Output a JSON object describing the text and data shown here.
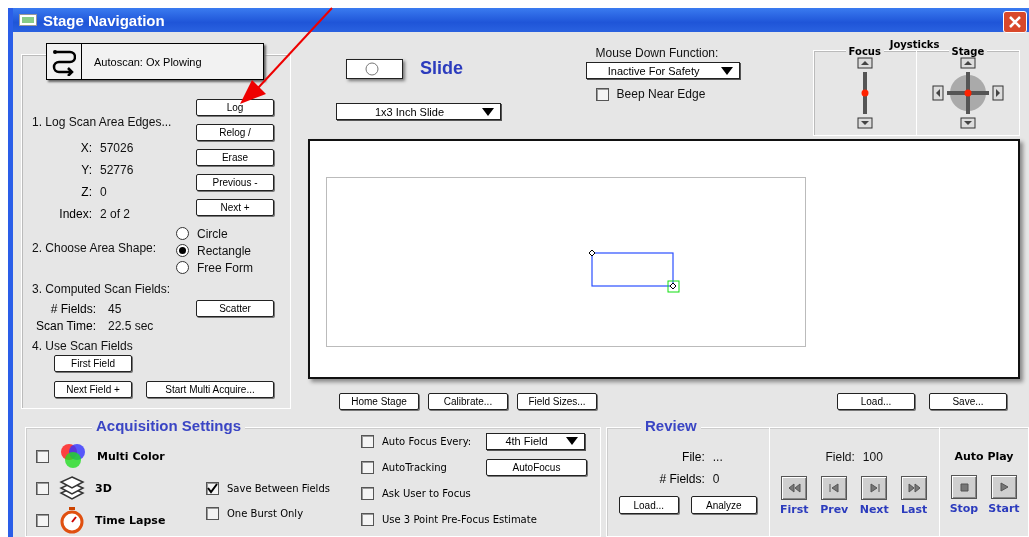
{
  "window": {
    "title": "Stage Navigation"
  },
  "autoscan": {
    "label": "Autoscan: Ox Plowing"
  },
  "log_section": {
    "heading": "1. Log Scan Area Edges...",
    "coords": [
      {
        "label": "X:",
        "value": "57026"
      },
      {
        "label": "Y:",
        "value": "52776"
      },
      {
        "label": "Z:",
        "value": "0"
      },
      {
        "label": "Index:",
        "value": "2 of 2"
      }
    ],
    "buttons": [
      "Log",
      "Relog  /",
      "Erase",
      "Previous -",
      "Next   +"
    ]
  },
  "shape_section": {
    "heading": "2. Choose Area Shape:",
    "options": [
      {
        "label": "Circle",
        "selected": false
      },
      {
        "label": "Rectangle",
        "selected": true
      },
      {
        "label": "Free Form",
        "selected": false
      }
    ]
  },
  "computed": {
    "heading": "3. Computed Scan Fields:",
    "rows": [
      {
        "label": "# Fields:",
        "value": "45"
      },
      {
        "label": "Scan Time:",
        "value": "22.5 sec"
      }
    ],
    "button": "Scatter"
  },
  "use_fields": {
    "heading": "4. Use Scan Fields",
    "buttons": [
      "First Field",
      "Next Field +",
      "Start Multi Acquire..."
    ]
  },
  "slide": {
    "title": "Slide",
    "dropdown": "1x3 Inch Slide"
  },
  "mouse_down": {
    "label": "Mouse Down Function:",
    "value": "Inactive For Safety"
  },
  "beep": {
    "label": "Beep Near Edge",
    "checked": false
  },
  "joysticks": {
    "title": "Joysticks",
    "focus_label": "Focus",
    "stage_label": "Stage"
  },
  "stage_buttons": [
    "Home Stage",
    "Calibrate...",
    "Field Sizes..."
  ],
  "file_buttons": [
    "Load...",
    "Save..."
  ],
  "acquisition": {
    "title": "Acquisition Settings",
    "modes": [
      {
        "kind": "multicolor",
        "label": "Multi Color",
        "checked": false
      },
      {
        "kind": "layers",
        "label": "3D",
        "checked": false
      },
      {
        "kind": "timer",
        "label": "Time Lapse",
        "checked": false
      }
    ],
    "options": [
      {
        "label": "Save Between Fields",
        "checked": true
      },
      {
        "label": "One Burst Only",
        "checked": false
      }
    ],
    "focus_options": [
      {
        "kind": "dropdown",
        "label": "Auto Focus Every:",
        "checked": false,
        "control": "4th Field"
      },
      {
        "kind": "button",
        "label": "AutoTracking",
        "checked": false,
        "control": "AutoFocus"
      },
      {
        "kind": "plain",
        "label": "Ask User to Focus",
        "checked": false
      },
      {
        "kind": "plain",
        "label": "Use 3 Point Pre-Focus Estimate",
        "checked": false
      }
    ]
  },
  "review": {
    "title": "Review",
    "file_label": "File:",
    "file_value": "...",
    "fields_label": "# Fields:",
    "fields_value": "0",
    "buttons": [
      "Load...",
      "Analyze"
    ],
    "field_label": "Field:",
    "field_value": "100",
    "nav": [
      {
        "kind": "first",
        "label": "First"
      },
      {
        "kind": "prev",
        "label": "Prev"
      },
      {
        "kind": "next",
        "label": "Next"
      },
      {
        "kind": "last",
        "label": "Last"
      }
    ],
    "autoplay": {
      "title": "Auto Play",
      "controls": [
        {
          "kind": "stop",
          "label": "Stop"
        },
        {
          "kind": "start",
          "label": "Start"
        }
      ]
    }
  }
}
